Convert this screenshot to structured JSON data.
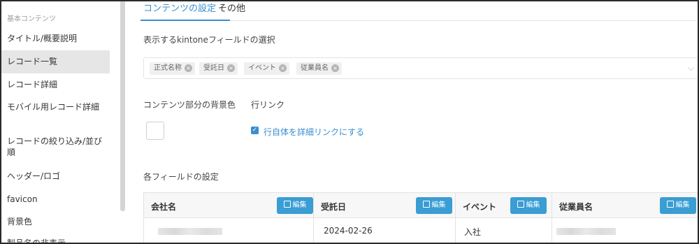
{
  "sidebar": {
    "section_title": "基本コンテンツ",
    "items": [
      {
        "label": "タイトル/概要説明"
      },
      {
        "label": "レコード一覧"
      },
      {
        "label": "レコード詳細"
      },
      {
        "label": "モバイル用レコード詳細"
      },
      {
        "label": "レコードの絞り込み/並び順"
      },
      {
        "label": "ヘッダー/ロゴ"
      },
      {
        "label": "favicon"
      },
      {
        "label": "背景色"
      },
      {
        "label": "製品名の非表示"
      }
    ]
  },
  "tabs": [
    {
      "label": "コンテンツの設定"
    },
    {
      "label": "その他"
    }
  ],
  "fields_section": {
    "title": "表示するkintoneフィールドの選択",
    "chips": [
      {
        "label": "正式名称"
      },
      {
        "label": "受託日"
      },
      {
        "label": "イベント"
      },
      {
        "label": "従業員名"
      }
    ],
    "remove_symbol": "×",
    "dropdown_symbol": "⌵"
  },
  "bg_color": {
    "label": "コンテンツ部分の背景色"
  },
  "row_link": {
    "label": "行リンク",
    "checkbox_label": "行自体を詳細リンクにする",
    "checked": true,
    "check_symbol": "✓"
  },
  "field_settings": {
    "title": "各フィールドの設定",
    "edit_label": "編集",
    "columns": [
      {
        "header": "会社名",
        "value": ""
      },
      {
        "header": "受託日",
        "value": "2024-02-26"
      },
      {
        "header": "イベント",
        "value": "入社"
      },
      {
        "header": "従業員名",
        "value": ""
      }
    ]
  },
  "colors": {
    "accent": "#3a8fd0",
    "button": "#3a9dd3"
  }
}
